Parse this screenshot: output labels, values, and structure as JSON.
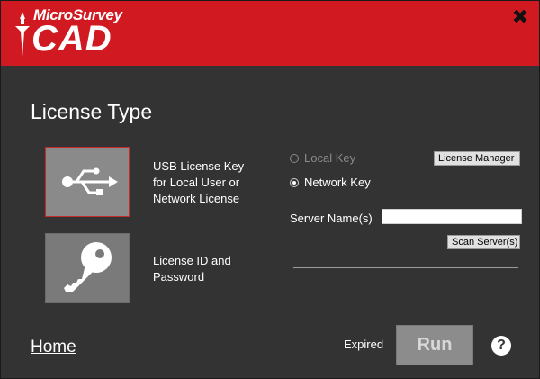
{
  "app": {
    "logo_top": "MicroSurvey",
    "logo_main": "CAD",
    "close_glyph": "✖"
  },
  "page": {
    "title": "License Type"
  },
  "options": {
    "usb": {
      "label_line1": "USB License Key",
      "label_line2": "for Local User or",
      "label_line3": "Network License",
      "icon": "usb-icon"
    },
    "key": {
      "label_line1": "License ID and",
      "label_line2": "Password",
      "icon": "key-icon"
    }
  },
  "usb_settings": {
    "local_key_label": "Local Key",
    "network_key_label": "Network Key",
    "selected": "Network Key",
    "license_manager_label": "License Manager",
    "server_name_label": "Server Name(s)",
    "server_name_value": "",
    "scan_servers_label": "Scan Server(s)"
  },
  "footer": {
    "home_label": "Home",
    "status": "Expired",
    "run_label": "Run",
    "help_glyph": "?"
  },
  "colors": {
    "header_red": "#d01921",
    "background": "#333333",
    "tile_gray": "#7a7a7a",
    "selected_border": "#c62b2b"
  }
}
